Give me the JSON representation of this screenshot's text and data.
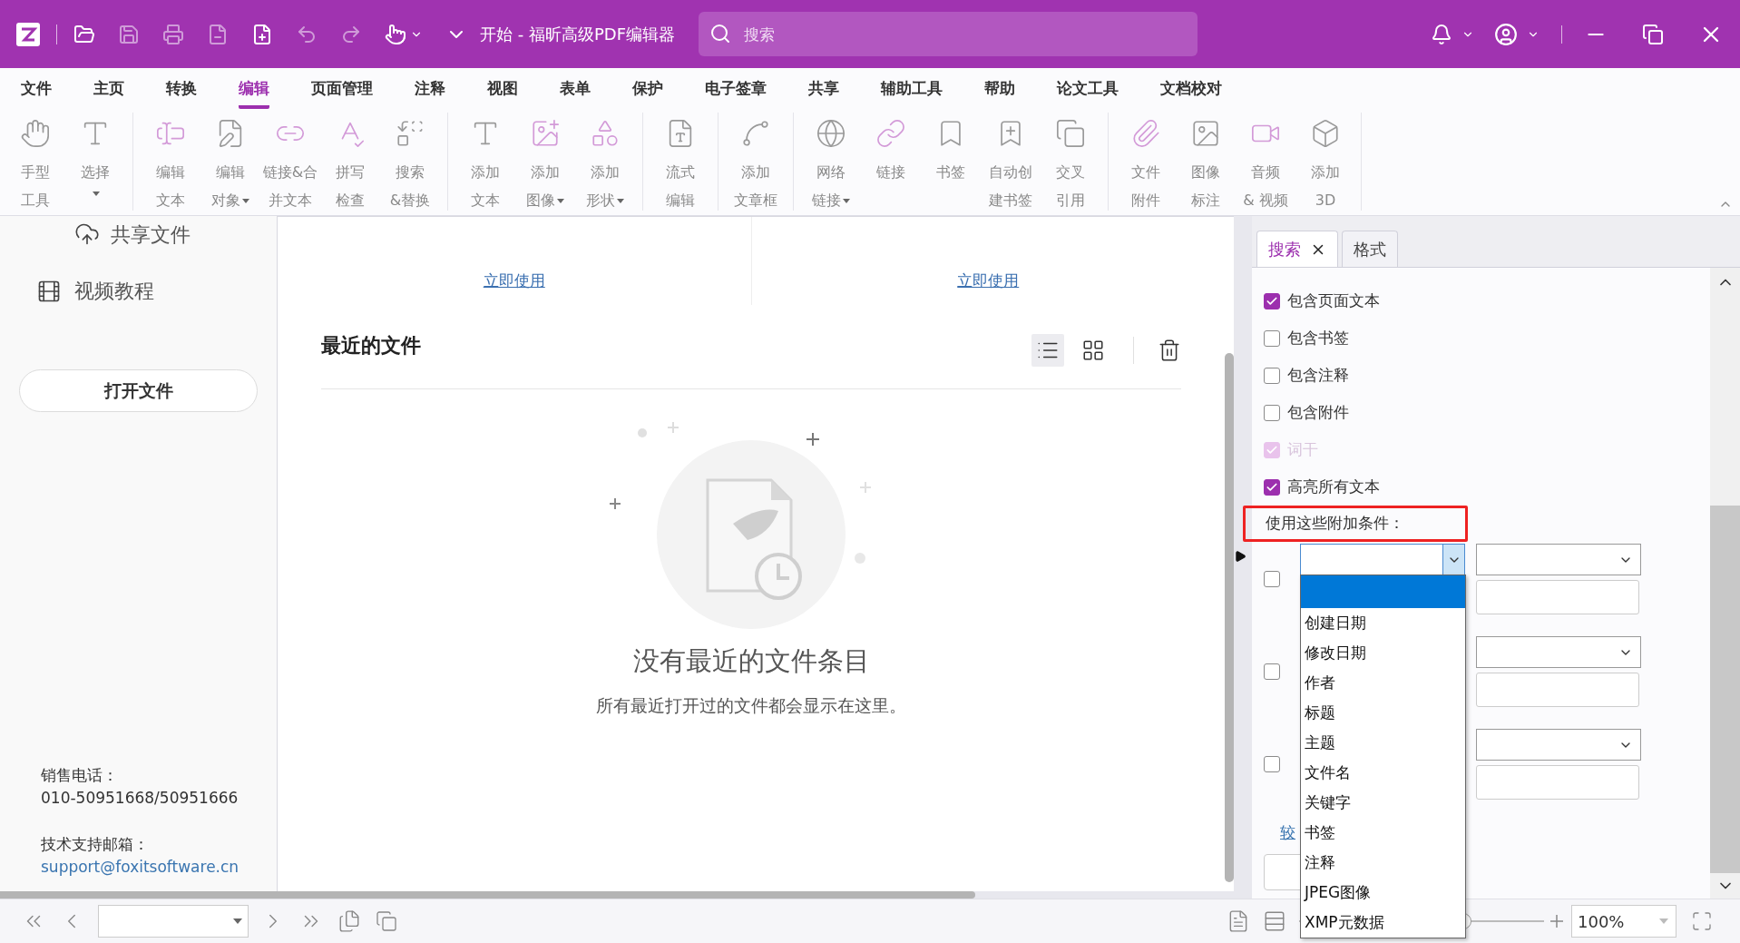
{
  "title_bar": {
    "title": "开始 - 福昕高级PDF编辑器",
    "search": {
      "placeholder": "搜索"
    }
  },
  "menu_tabs": [
    {
      "label": "文件",
      "selected": false
    },
    {
      "label": "主页",
      "selected": false
    },
    {
      "label": "转换",
      "selected": false
    },
    {
      "label": "编辑",
      "selected": true
    },
    {
      "label": "页面管理",
      "selected": false
    },
    {
      "label": "注释",
      "selected": false
    },
    {
      "label": "视图",
      "selected": false
    },
    {
      "label": "表单",
      "selected": false
    },
    {
      "label": "保护",
      "selected": false
    },
    {
      "label": "电子签章",
      "selected": false
    },
    {
      "label": "共享",
      "selected": false
    },
    {
      "label": "辅助工具",
      "selected": false
    },
    {
      "label": "帮助",
      "selected": false
    },
    {
      "label": "论文工具",
      "selected": false
    },
    {
      "label": "文档校对",
      "selected": false
    }
  ],
  "ribbon": {
    "groups": [
      {
        "tools": [
          {
            "lines": [
              "手型",
              "工具"
            ],
            "dropdown": false
          },
          {
            "lines": [
              "选择"
            ],
            "dropdown": true
          }
        ]
      },
      {
        "tools": [
          {
            "lines": [
              "编辑",
              "文本"
            ],
            "dropdown": false
          },
          {
            "lines": [
              "编辑",
              "对象"
            ],
            "dropdown": true
          },
          {
            "lines": [
              "链接&合",
              "并文本"
            ],
            "dropdown": false
          },
          {
            "lines": [
              "拼写",
              "检查"
            ],
            "dropdown": false
          },
          {
            "lines": [
              "搜索",
              "&替换"
            ],
            "dropdown": false
          }
        ]
      },
      {
        "tools": [
          {
            "lines": [
              "添加",
              "文本"
            ],
            "dropdown": false
          },
          {
            "lines": [
              "添加",
              "图像"
            ],
            "dropdown": true
          },
          {
            "lines": [
              "添加",
              "形状"
            ],
            "dropdown": true
          }
        ]
      },
      {
        "tools": [
          {
            "lines": [
              "流式",
              "编辑"
            ],
            "dropdown": false
          }
        ]
      },
      {
        "tools": [
          {
            "lines": [
              "添加",
              "文章框"
            ],
            "dropdown": false
          }
        ]
      },
      {
        "tools": [
          {
            "lines": [
              "网络",
              "链接"
            ],
            "dropdown": true
          },
          {
            "lines": [
              "链接"
            ],
            "dropdown": false
          },
          {
            "lines": [
              "书签"
            ],
            "dropdown": false
          },
          {
            "lines": [
              "自动创",
              "建书签"
            ],
            "dropdown": false
          },
          {
            "lines": [
              "交叉",
              "引用"
            ],
            "dropdown": false
          }
        ]
      },
      {
        "tools": [
          {
            "lines": [
              "文件",
              "附件"
            ],
            "dropdown": false
          },
          {
            "lines": [
              "图像",
              "标注"
            ],
            "dropdown": false
          },
          {
            "lines": [
              "音频",
              "& 视频"
            ],
            "dropdown": false
          },
          {
            "lines": [
              "添加",
              "3D"
            ],
            "dropdown": false
          }
        ]
      }
    ]
  },
  "sidebar": {
    "items": [
      "共享文件",
      "视频教程"
    ],
    "open_button": "打开文件",
    "contact": [
      {
        "kind": "text",
        "label": "销售电话：",
        "value": "010-50951668/50951666"
      },
      {
        "kind": "link",
        "label": "技术支持邮箱：",
        "value": "support@foxitsoftware.cn"
      }
    ]
  },
  "center": {
    "links": [
      "立即使用",
      "立即使用"
    ],
    "recent_title": "最近的文件",
    "views": [
      {
        "kind": "list",
        "selected": true
      },
      {
        "kind": "grid",
        "selected": false
      }
    ],
    "empty_title": "没有最近的文件条目",
    "empty_text": "所有最近打开过的文件都会显示在这里。"
  },
  "search_panel": {
    "tabs": [
      {
        "label": "搜索",
        "selected": true,
        "closable": true
      },
      {
        "label": "格式",
        "selected": false,
        "closable": false
      }
    ],
    "options": [
      {
        "label": "包含页面文本",
        "checked": true,
        "disabled": false
      },
      {
        "label": "包含书签",
        "checked": false,
        "disabled": false
      },
      {
        "label": "包含注释",
        "checked": false,
        "disabled": false
      },
      {
        "label": "包含附件",
        "checked": false,
        "disabled": false
      },
      {
        "label": "词干",
        "checked": true,
        "disabled": true
      },
      {
        "label": "高亮所有文本",
        "checked": true,
        "disabled": false
      }
    ],
    "conditions_label": "使用这些附加条件：",
    "conditions_highlighted": true,
    "conditions": [
      {
        "checked": false,
        "open": true
      },
      {
        "checked": false,
        "open": false
      },
      {
        "checked": false,
        "open": false
      }
    ],
    "fewer_link": "较",
    "dropdown": {
      "blank_item_selected": true,
      "items": [
        {
          "label": "创建日期",
          "selected": false
        },
        {
          "label": "修改日期",
          "selected": false
        },
        {
          "label": "作者",
          "selected": false
        },
        {
          "label": "标题",
          "selected": false
        },
        {
          "label": "主题",
          "selected": false
        },
        {
          "label": "文件名",
          "selected": false
        },
        {
          "label": "关键字",
          "selected": false
        },
        {
          "label": "书签",
          "selected": false
        },
        {
          "label": "注释",
          "selected": false
        },
        {
          "label": "JPEG图像",
          "selected": false
        },
        {
          "label": "XMP元数据",
          "selected": false
        }
      ]
    }
  },
  "status_bar": {
    "zoom_slider": {
      "level": 0.67
    },
    "zoom": "100%"
  }
}
